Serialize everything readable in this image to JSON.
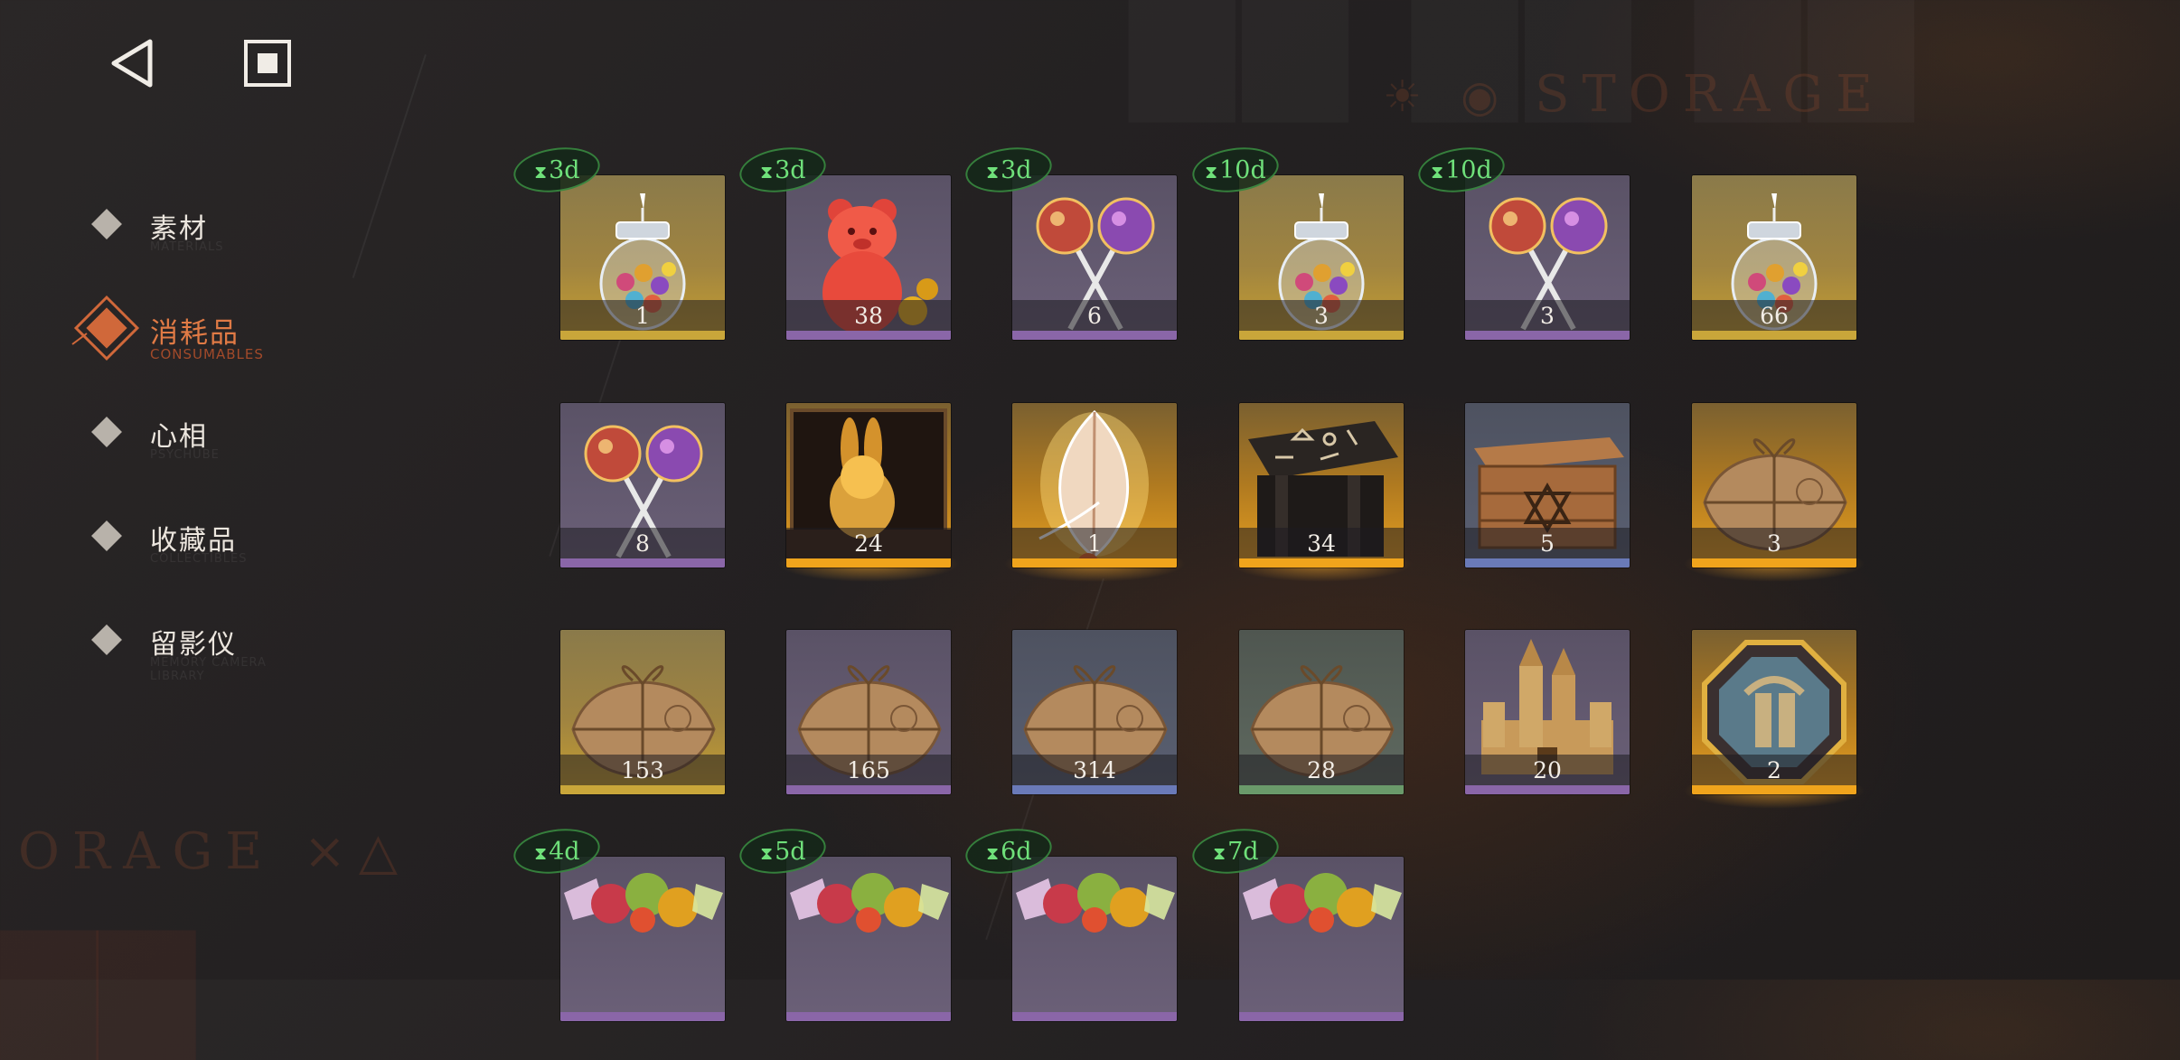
{
  "header": {
    "back_icon": "back-triangle-icon",
    "home_icon": "home-square-icon",
    "watermark_top": "STORAGE",
    "watermark_left": "ORAGE ×△"
  },
  "nav": {
    "items": [
      {
        "label": "素材",
        "sub": "MATERIALS",
        "active": false
      },
      {
        "label": "消耗品",
        "sub": "CONSUMABLES",
        "active": true
      },
      {
        "label": "心相",
        "sub": "PSYCHUBE",
        "active": false
      },
      {
        "label": "收藏品",
        "sub": "COLLECTIBLES",
        "active": false
      },
      {
        "label": "留影仪",
        "sub": "MEMORY CAMERA LIBRARY",
        "active": false
      }
    ],
    "active_color": "#e07a45"
  },
  "inventory": {
    "rows": [
      [
        {
          "icon": "candy-jar-icon",
          "count": "1",
          "timer": "3d",
          "rarity": "gold"
        },
        {
          "icon": "gummy-bear-icon",
          "count": "38",
          "timer": "3d",
          "rarity": "purple"
        },
        {
          "icon": "lollipops-icon",
          "count": "6",
          "timer": "3d",
          "rarity": "purple"
        },
        {
          "icon": "candy-jar-icon",
          "count": "3",
          "timer": "10d",
          "rarity": "gold"
        },
        {
          "icon": "lollipops-icon",
          "count": "3",
          "timer": "10d",
          "rarity": "purple"
        },
        {
          "icon": "candy-jar-icon",
          "count": "66",
          "timer": null,
          "rarity": "gold"
        }
      ],
      [
        {
          "icon": "lollipops-icon",
          "count": "8",
          "timer": null,
          "rarity": "purple"
        },
        {
          "icon": "golden-rabbit-box-icon",
          "count": "24",
          "timer": null,
          "rarity": "gold-bright"
        },
        {
          "icon": "glowing-feather-icon",
          "count": "1",
          "timer": null,
          "rarity": "gold-bright"
        },
        {
          "icon": "rune-table-icon",
          "count": "34",
          "timer": null,
          "rarity": "gold-bright"
        },
        {
          "icon": "wooden-crate-icon",
          "count": "5",
          "timer": null,
          "rarity": "blue"
        },
        {
          "icon": "parcel-icon",
          "count": "3",
          "timer": null,
          "rarity": "gold-bright"
        }
      ],
      [
        {
          "icon": "parcel-icon",
          "count": "153",
          "timer": null,
          "rarity": "gold"
        },
        {
          "icon": "parcel-icon",
          "count": "165",
          "timer": null,
          "rarity": "purple"
        },
        {
          "icon": "parcel-icon",
          "count": "314",
          "timer": null,
          "rarity": "blue"
        },
        {
          "icon": "parcel-icon",
          "count": "28",
          "timer": null,
          "rarity": "green"
        },
        {
          "icon": "sand-castle-icon",
          "count": "20",
          "timer": null,
          "rarity": "purple"
        },
        {
          "icon": "octagon-medal-icon",
          "count": "2",
          "timer": null,
          "rarity": "gold-bright"
        }
      ],
      [
        {
          "icon": "wrapped-candies-icon",
          "count": "",
          "timer": "4d",
          "rarity": "purple"
        },
        {
          "icon": "wrapped-candies-icon",
          "count": "",
          "timer": "5d",
          "rarity": "purple"
        },
        {
          "icon": "wrapped-candies-icon",
          "count": "",
          "timer": "6d",
          "rarity": "purple"
        },
        {
          "icon": "wrapped-candies-icon",
          "count": "",
          "timer": "7d",
          "rarity": "purple"
        }
      ]
    ],
    "rarity_colors": {
      "gold": "#c9a63a",
      "gold-bright": "#f0a41c",
      "purple": "#8a66a8",
      "blue": "#6a7ab8",
      "green": "#6a9a6a"
    }
  }
}
